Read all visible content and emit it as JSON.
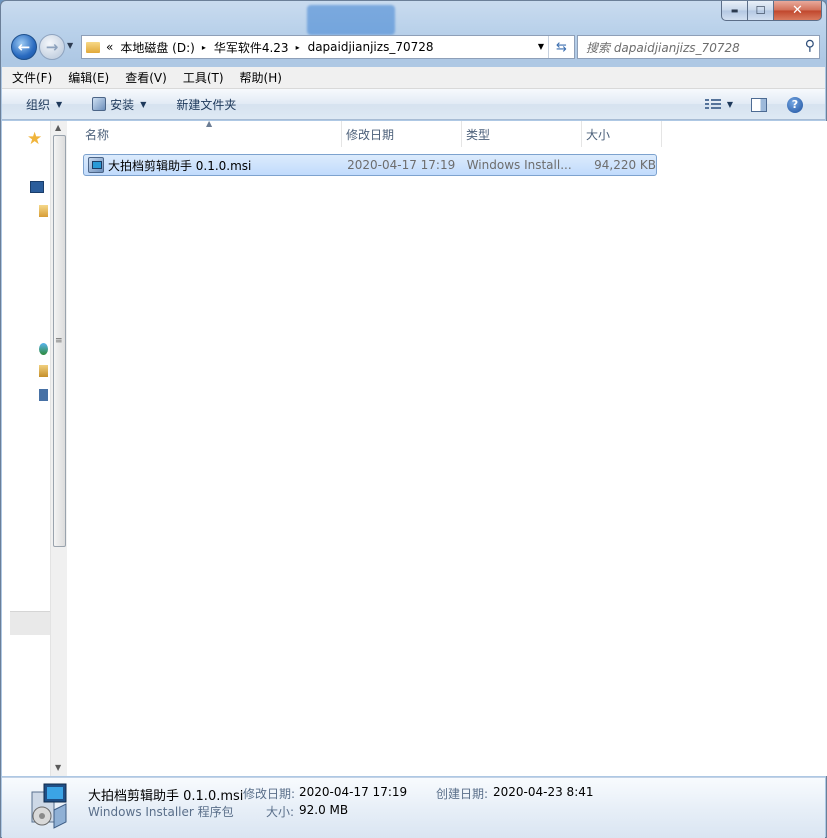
{
  "titlebar": {
    "minimize_glyph": "▬",
    "maximize_glyph": "☐",
    "close_glyph": "✕"
  },
  "address_bar": {
    "overflow": "«",
    "segments": [
      "本地磁盘 (D:)",
      "华军软件4.23",
      "dapaidjianjizs_70728"
    ],
    "separator": "▸"
  },
  "search": {
    "placeholder": "搜索 dapaidjianjizs_70728"
  },
  "menu": {
    "items": [
      "文件(F)",
      "编辑(E)",
      "查看(V)",
      "工具(T)",
      "帮助(H)"
    ]
  },
  "toolbar": {
    "organize_label": "组织",
    "install_label": "安装",
    "new_folder_label": "新建文件夹"
  },
  "columns": {
    "name": "名称",
    "date": "修改日期",
    "type": "类型",
    "size": "大小"
  },
  "files": [
    {
      "name": "大拍档剪辑助手 0.1.0.msi",
      "date": "2020-04-17 17:19",
      "type": "Windows Install...",
      "size": "94,220 KB"
    }
  ],
  "details": {
    "name": "大拍档剪辑助手 0.1.0.msi",
    "type": "Windows Installer 程序包",
    "modified_label": "修改日期:",
    "modified_value": "2020-04-17 17:19",
    "created_label": "创建日期:",
    "created_value": "2020-04-23 8:41",
    "size_label": "大小:",
    "size_value": "92.0 MB"
  },
  "icons": {
    "back": "back-arrow-icon",
    "forward": "forward-arrow-icon",
    "search": "magnifier-icon",
    "favorites": "star-icon",
    "help": "help-icon"
  },
  "colors": {
    "window_frame": "#b9d1ea",
    "selection_fill": "#c1dbfc",
    "selection_border": "#7da2ce",
    "close_button": "#c0462c"
  }
}
